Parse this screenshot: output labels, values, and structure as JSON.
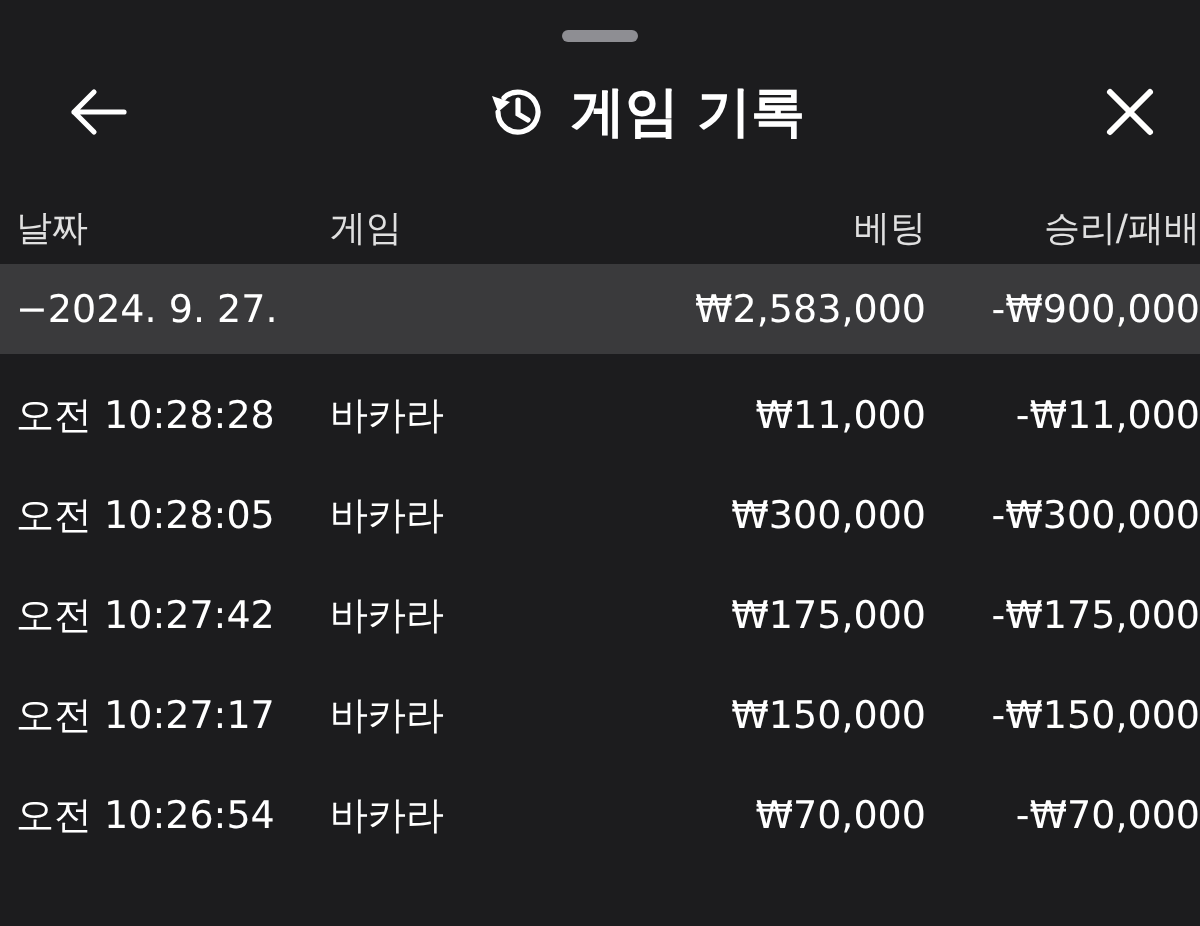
{
  "header": {
    "title": "게임 기록"
  },
  "columns": [
    "날짜",
    "게임",
    "베팅",
    "승리/패배"
  ],
  "rows": [
    {
      "kind": "group",
      "date": "−2024. 9. 27.",
      "bet": "₩2,583,000",
      "result": "-₩900,000"
    },
    {
      "kind": "entry",
      "date": "오전 10:28:28",
      "game": "바카라",
      "bet": "₩11,000",
      "result": "-₩11,000"
    },
    {
      "kind": "entry",
      "date": "오전 10:28:05",
      "game": "바카라",
      "bet": "₩300,000",
      "result": "-₩300,000"
    },
    {
      "kind": "entry",
      "date": "오전 10:27:42",
      "game": "바카라",
      "bet": "₩175,000",
      "result": "-₩175,000"
    },
    {
      "kind": "entry",
      "date": "오전 10:27:17",
      "game": "바카라",
      "bet": "₩150,000",
      "result": "-₩150,000"
    },
    {
      "kind": "entry",
      "date": "오전 10:26:54",
      "game": "바카라",
      "bet": "₩70,000",
      "result": "-₩70,000"
    }
  ]
}
